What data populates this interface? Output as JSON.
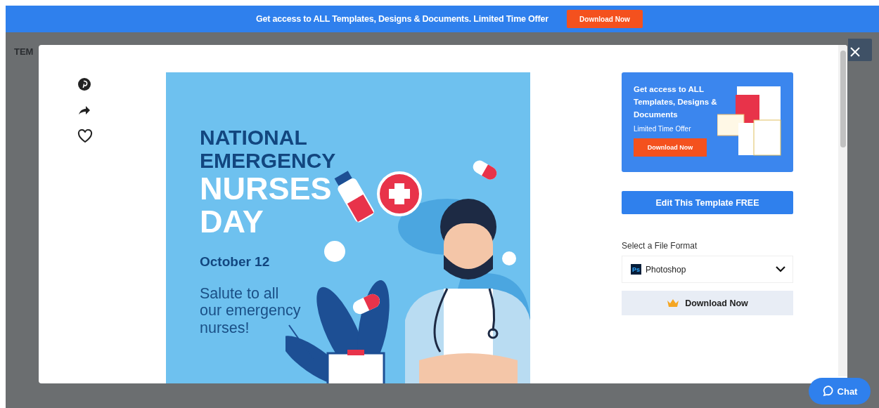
{
  "banner": {
    "text": "Get access to ALL Templates, Designs & Documents. Limited Time Offer",
    "button": "Download Now"
  },
  "background_page": {
    "title": "TEM"
  },
  "modal": {
    "preview": {
      "headline": [
        {
          "text": "NATIONAL",
          "kind": "dark"
        },
        {
          "text": "EMERGENCY",
          "kind": "dark"
        },
        {
          "text": "NURSES",
          "kind": "light"
        },
        {
          "text": "DAY",
          "kind": "light"
        }
      ],
      "date": "October 12",
      "message": "Salute to all our emergency nurses!"
    },
    "promo": {
      "text": "Get access to ALL Templates, Designs & Documents",
      "subtext": "Limited Time Offer",
      "button": "Download Now"
    },
    "edit_button": "Edit This Template FREE",
    "format_label": "Select a File Format",
    "format": {
      "badge": "Ps",
      "value": "Photoshop"
    },
    "download_button": "Download Now"
  },
  "chat_button": "Chat"
}
